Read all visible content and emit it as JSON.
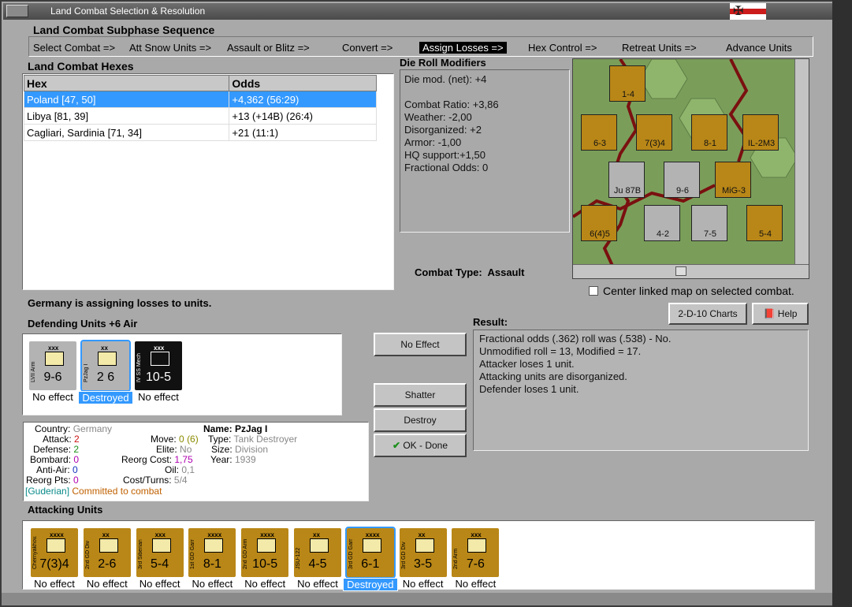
{
  "window": {
    "title": "Land Combat Selection & Resolution"
  },
  "sequence": {
    "heading": "Land Combat Subphase Sequence",
    "steps": [
      "Select Combat =>",
      "Att Snow Units =>",
      "Assault or Blitz =>",
      "Convert =>",
      "Assign Losses =>",
      "Hex Control =>",
      "Retreat Units =>",
      "Advance Units"
    ]
  },
  "hexes": {
    "heading": "Land Combat Hexes",
    "columns": [
      "Hex",
      "Odds"
    ],
    "rows": [
      {
        "hex": "Poland [47, 50]",
        "odds": "+4,362 (56:29)"
      },
      {
        "hex": "Libya [81, 39]",
        "odds": "+13 (+14B) (26:4)"
      },
      {
        "hex": "Cagliari, Sardinia [71, 34]",
        "odds": "+21 (11:1)"
      }
    ]
  },
  "die_roll": {
    "heading": "Die Roll Modifiers",
    "lines": [
      "Die mod. (net): +4",
      "",
      "Combat Ratio: +3,86",
      "Weather: -2,00",
      "Disorganized: +2",
      "Armor: -1,00",
      "HQ support:+1,50",
      "Fractional Odds: 0"
    ]
  },
  "combat_type": {
    "label": "Combat Type:",
    "value": "Assault"
  },
  "center_map": {
    "label": "Center linked map on selected combat."
  },
  "status": "Germany is assigning losses to units.",
  "defending": {
    "heading": "Defending Units +6 Air",
    "units": [
      {
        "cls": "xxx",
        "name": "LVII Arm",
        "strength": "9-6",
        "caption": "No effect",
        "color": "#b3b3b3",
        "selected": false
      },
      {
        "cls": "xx",
        "name": "PzJag I",
        "strength": "2 6",
        "caption": "Destroyed",
        "color": "#b3b3b3",
        "selected": true
      },
      {
        "cls": "xxx",
        "name": "IV SS Mech",
        "strength": "10-5",
        "caption": "No effect",
        "color": "#111111",
        "selected": false
      }
    ]
  },
  "buttons": {
    "no_effect": "No Effect",
    "shatter": "Shatter",
    "destroy": "Destroy",
    "ok_done": "OK - Done",
    "charts": "2-D-10 Charts",
    "help": "Help"
  },
  "result": {
    "heading": "Result:",
    "lines": [
      "Fractional odds (.362) roll was (.538)  - No.",
      "Unmodified roll = 13, Modified = 17.",
      "Attacker loses 1 unit.",
      "Attacking units are disorganized.",
      "Defender loses 1 unit."
    ]
  },
  "unit_info": {
    "country_label": "Country:",
    "country": "Germany",
    "attack_label": "Attack:",
    "attack": "2",
    "defense_label": "Defense:",
    "defense": "2",
    "bombard_label": "Bombard:",
    "bombard": "0",
    "antiair_label": "Anti-Air:",
    "antiair": "0",
    "reorg_label": "Reorg Pts:",
    "reorg": "0",
    "leader": "[Guderian]",
    "committed": "Committed to combat",
    "move_label": "Move:",
    "move": "0",
    "move_paren": "(6)",
    "elite_label": "Elite:",
    "elite": "No",
    "reorg_cost_label": "Reorg Cost:",
    "reorg_cost": "1,75",
    "oil_label": "Oil:",
    "oil": "0,1",
    "cost_label": "Cost/Turns:",
    "cost": "5/4",
    "name_label": "Name:",
    "name": "PzJag I",
    "type_label": "Type:",
    "type": "Tank Destroyer",
    "size_label": "Size:",
    "size": "Division",
    "year_label": "Year:",
    "year": "1939"
  },
  "attacking": {
    "heading": "Attacking Units",
    "units": [
      {
        "cls": "xxxx",
        "name": "Chernyakhov.",
        "strength": "7(3)4",
        "caption": "No effect",
        "selected": false
      },
      {
        "cls": "xx",
        "name": "2nd GD Div",
        "strength": "2-6",
        "caption": "No effect",
        "selected": false
      },
      {
        "cls": "xxx",
        "name": "3rd Siberian",
        "strength": "5-4",
        "caption": "No effect",
        "selected": false
      },
      {
        "cls": "xxxx",
        "name": "1st GD Garr",
        "strength": "8-1",
        "caption": "No effect",
        "selected": false
      },
      {
        "cls": "xxxx",
        "name": "2nd GD Arm",
        "strength": "10-5",
        "caption": "No effect",
        "selected": false
      },
      {
        "cls": "xx",
        "name": "JSU-122",
        "strength": "4-5",
        "caption": "No effect",
        "selected": false
      },
      {
        "cls": "xxxx",
        "name": "3rd GD Garr",
        "strength": "6-1",
        "caption": "Destroyed",
        "selected": true
      },
      {
        "cls": "xx",
        "name": "3rd GD Div",
        "strength": "3-5",
        "caption": "No effect",
        "selected": false
      },
      {
        "cls": "xxx",
        "name": "2nd Arm",
        "strength": "7-6",
        "caption": "No effect",
        "selected": false
      }
    ]
  },
  "map_counters": [
    {
      "strength": "1-4"
    },
    {
      "strength": "6-3"
    },
    {
      "strength": "7(3)4"
    },
    {
      "strength": "8-1"
    },
    {
      "strength": "9-6"
    },
    {
      "strength": "Ju 87B"
    },
    {
      "strength": "IL-2M3"
    },
    {
      "strength": "MiG-3"
    },
    {
      "strength": "6(4)5"
    },
    {
      "strength": "4-2"
    },
    {
      "strength": "7-5"
    },
    {
      "strength": "5-4"
    }
  ],
  "colors": {
    "panel": "#a9a9a9",
    "selection": "#3399ff",
    "soviet_counter": "#b98717",
    "german_counter": "#b3b3b3",
    "red": "#cc1111"
  }
}
